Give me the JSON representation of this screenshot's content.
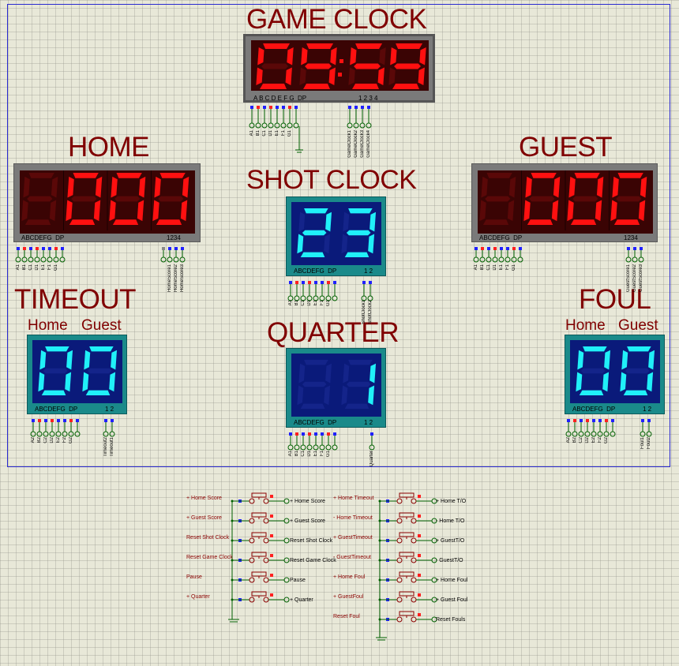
{
  "titles": {
    "game_clock": "GAME CLOCK",
    "home": "HOME",
    "guest": "GUEST",
    "shot_clock": "SHOT CLOCK",
    "timeout": "TIMEOUT",
    "foul": "FOUL",
    "quarter": "QUARTER"
  },
  "subtitles": {
    "timeout_home": "Home",
    "timeout_guest": "Guest",
    "foul_home": "Home",
    "foul_guest": "Guest"
  },
  "displays": {
    "game_clock": {
      "digits": [
        "0",
        "9",
        "5",
        "9"
      ],
      "colon": true,
      "label_left": "A B C D E F G  DP",
      "label_right": "1 2 3 4"
    },
    "home": {
      "digits": [
        "",
        "0",
        "0",
        "0"
      ],
      "label_left": "ABCDEFG  DP",
      "label_right": "1234"
    },
    "guest": {
      "digits": [
        "",
        "0",
        "0",
        "0"
      ],
      "label_left": "ABCDEFG  DP",
      "label_right": "1234"
    },
    "shot_clock": {
      "digits": [
        "2",
        "3"
      ],
      "label_left": "ABCDEFG  DP",
      "label_right": "1 2"
    },
    "timeout": {
      "digits": [
        "0",
        "0"
      ],
      "label_left": "ABCDEFG  DP",
      "label_right": "1 2"
    },
    "quarter": {
      "digits": [
        "",
        "1"
      ],
      "label_left": "ABCDEFG  DP",
      "label_right": "1 2"
    },
    "foul": {
      "digits": [
        "0",
        "0"
      ],
      "label_left": "ABCDEFG  DP",
      "label_right": "1 2"
    }
  },
  "pin_labels": {
    "game_clock_segments": [
      "A1",
      "B1",
      "C1",
      "D1",
      "E1",
      "F1",
      "G1"
    ],
    "game_clock_digits": [
      "GameClock1",
      "GameClock2",
      "GameClock3",
      "GameClock4"
    ],
    "home_segments": [
      "A1",
      "B1",
      "C1",
      "D1",
      "E1",
      "F1",
      "G1"
    ],
    "home_digits": [
      "HomeScore1",
      "HomeScore2",
      "HomeScore3"
    ],
    "guest_segments": [
      "A1",
      "B1",
      "C1",
      "D1",
      "E1",
      "F1",
      "G1"
    ],
    "guest_digits": [
      "GuestScore1",
      "GuestScore2",
      "GuestScore3"
    ],
    "shot_segments": [
      "A1",
      "B1",
      "C1",
      "D1",
      "E1",
      "F1",
      "G1"
    ],
    "shot_digits": [
      "ShotClock1",
      "ShotClock2"
    ],
    "timeout_segments": [
      "A2",
      "B2",
      "C2",
      "D2",
      "E2",
      "F2",
      "G2"
    ],
    "timeout_digits": [
      "Timeout2",
      "Timeout1"
    ],
    "quarter_segments": [
      "A1",
      "B1",
      "C1",
      "D1",
      "E1",
      "F1",
      "G1"
    ],
    "quarter_digits": [
      "Quarter"
    ],
    "foul_segments": [
      "A2",
      "B2",
      "C2",
      "D2",
      "E2",
      "F2",
      "G2"
    ],
    "foul_digits": [
      "Foul1",
      "Foul2"
    ]
  },
  "buttons_left": [
    {
      "in": "+ Home Score",
      "out": "+ Home Score"
    },
    {
      "in": "+ Guest Score",
      "out": "+ Guest Score"
    },
    {
      "in": "Reset Shot Clock",
      "out": "Reset Shot Clock"
    },
    {
      "in": "Reset Game Clock",
      "out": "Reset Game Clock"
    },
    {
      "in": "Pause",
      "out": "Pause"
    },
    {
      "in": "+ Quarter",
      "out": "+ Quarter"
    }
  ],
  "buttons_right": [
    {
      "in": "+ Home Timeout",
      "out": "+ Home T/O"
    },
    {
      "in": "- Home Timeout",
      "out": "- Home T/O"
    },
    {
      "in": "+ GuestTimeout",
      "out": "+ GuestT/O"
    },
    {
      "in": "- GuestTimeout",
      "out": "- GuestT/O"
    },
    {
      "in": "+ Home Foul",
      "out": "+ Home Foul"
    },
    {
      "in": "+ GuestFoul",
      "out": "+ Guest Foul"
    },
    {
      "in": "Reset Foul",
      "out": "Reset Fouls"
    }
  ],
  "colors": {
    "title": "#800000",
    "red_on": "#ff1010",
    "red_off": "#5a0808",
    "cyan_on": "#20f0f8",
    "cyan_off": "#14248a",
    "grid_bg": "#e8e8d8",
    "frame": "#2a2ad0"
  }
}
